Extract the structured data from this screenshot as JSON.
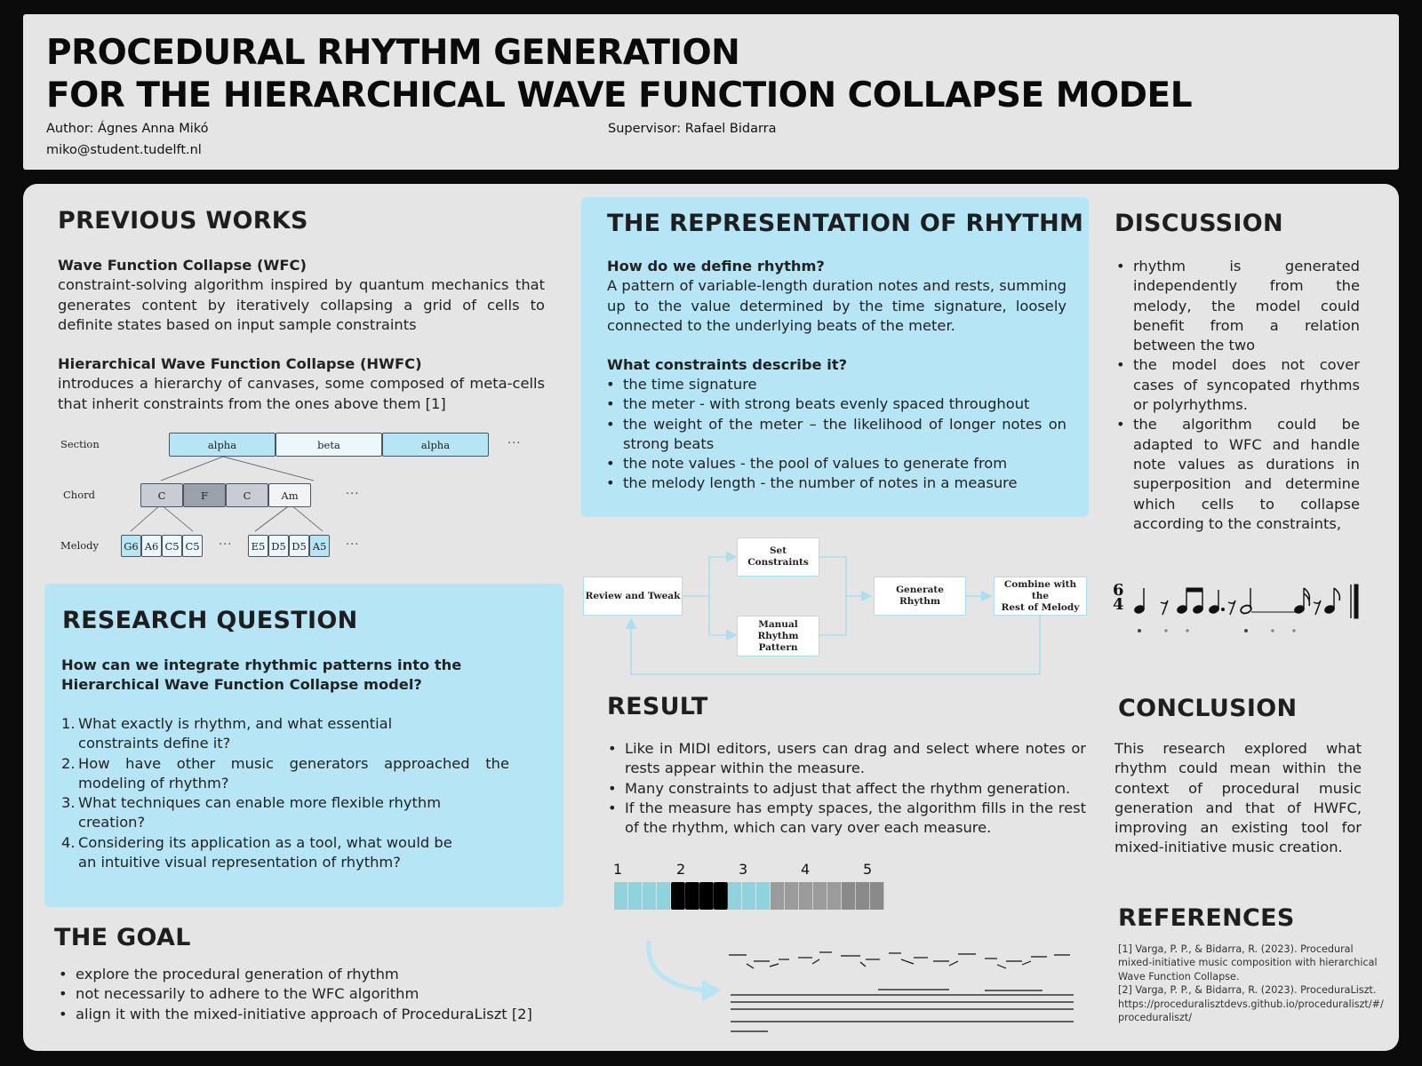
{
  "header": {
    "title_line1": "PROCEDURAL RHYTHM GENERATION",
    "title_line2": "FOR THE HIERARCHICAL WAVE FUNCTION COLLAPSE MODEL",
    "author": "Author: Ágnes Anna Mikó",
    "email": "miko@student.tudelft.nl",
    "supervisor": "Supervisor: Rafael Bidarra"
  },
  "previous_works": {
    "title": "PREVIOUS WORKS",
    "wfc_heading": "Wave Function Collapse (WFC)",
    "wfc_text": "constraint-solving algorithm inspired by quantum mechanics that generates content by iteratively collapsing a grid of cells to definite states based on input sample constraints",
    "hwfc_heading": "Hierarchical Wave Function Collapse (HWFC)",
    "hwfc_text": "introduces a hierarchy of canvases, some composed of meta-cells that inherit constraints from the ones above them [1]",
    "diagram": {
      "section_label": "Section",
      "chord_label": "Chord",
      "melody_label": "Melody",
      "sections": [
        "alpha",
        "beta",
        "alpha"
      ],
      "chords": [
        "C",
        "F",
        "C",
        "Am"
      ],
      "melody_left": [
        "G6",
        "A6",
        "C5",
        "C5"
      ],
      "melody_right": [
        "E5",
        "D5",
        "D5",
        "A5"
      ],
      "ellipsis": "···"
    }
  },
  "research_question": {
    "title": "RESEARCH QUESTION",
    "question": "How can we integrate rhythmic patterns into the Hierarchical Wave Function Collapse model?",
    "items": [
      {
        "num": "1.",
        "text": "What exactly is rhythm, and what essential constraints define it?"
      },
      {
        "num": "2.",
        "text": "How have other music generators approached the modeling of rhythm?"
      },
      {
        "num": "3.",
        "text": "What techniques can enable more flexible rhythm creation?"
      },
      {
        "num": "4.",
        "text": "Considering its application as a tool, what would be an intuitive visual representation of rhythm?"
      }
    ]
  },
  "goal": {
    "title": "THE GOAL",
    "items": [
      "explore the procedural generation of rhythm",
      "not necessarily to adhere to the WFC algorithm",
      "align it with the mixed-initiative approach of ProceduraLiszt [2]"
    ]
  },
  "representation": {
    "title": "THE REPRESENTATION OF RHYTHM",
    "q1": "How do we define rhythm?",
    "a1": "A pattern of variable-length duration notes and rests, summing up to the value determined by the time signature, loosely connected to the underlying beats of the meter.",
    "q2": "What constraints describe it?",
    "items": [
      "the time signature",
      "the meter - with strong beats evenly spaced throughout",
      "the weight of the meter – the likelihood of longer notes on strong beats",
      "the note values - the pool of values to generate from",
      "the melody length - the number of notes in a measure"
    ]
  },
  "flowchart": {
    "review": "Review and Tweak",
    "set_constraints": "Set Constraints",
    "manual_line1": "Manual Rhythm",
    "manual_line2": "Pattern",
    "generate": "Generate Rhythm",
    "combine_line1": "Combine with the",
    "combine_line2": "Rest of Melody"
  },
  "result": {
    "title": "RESULT",
    "items": [
      "Like in MIDI editors, users can drag and select where notes or rests appear within the measure.",
      "Many constraints to adjust that affect the rhythm generation.",
      "If the measure has empty spaces, the algorithm fills in the rest of the rhythm, which can vary over each measure."
    ],
    "beat_numbers": [
      "1",
      "2",
      "3",
      "4",
      "5"
    ],
    "colors": {
      "teal": "#8fd3de",
      "black": "#000000",
      "gray": "#9b9b9b",
      "dark_gray": "#8a8a8a"
    }
  },
  "discussion": {
    "title": "DISCUSSION",
    "items": [
      "rhythm is generated independently from the melody, the model could benefit from a relation between the two",
      "the model does not cover cases of syncopated rhythms or polyrhythms.",
      "the algorithm could be adapted to WFC and handle note values as durations in superposition and determine which cells to collapse according to the constraints,"
    ],
    "time_signature_top": "6",
    "time_signature_bottom": "4"
  },
  "conclusion": {
    "title": "CONCLUSION",
    "text": "This research explored what rhythm could mean within the context of procedural music generation and that of HWFC, improving an existing tool for mixed-initiative music creation."
  },
  "references": {
    "title": "REFERENCES",
    "ref1": "[1] Varga, P. P., & Bidarra, R. (2023). Procedural mixed-initiative music composition with hierarchical Wave Function Collapse.",
    "ref2": "[2] Varga, P. P., & Bidarra, R. (2023). ProceduraLiszt. https://proceduralisztdevs.github.io/proceduraliszt/#/proceduraliszt/"
  },
  "theme": {
    "light_blue": "#b6e6f5",
    "panel_gray": "#e5e5e5",
    "background": "#0a0a0a"
  }
}
